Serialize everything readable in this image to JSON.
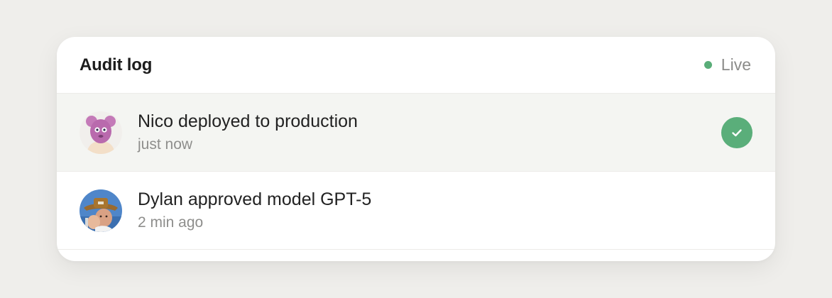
{
  "header": {
    "title": "Audit log",
    "status_label": "Live",
    "status_color": "#59ad78"
  },
  "entries": [
    {
      "text": "Nico deployed to production",
      "time": "just now",
      "avatar": "pink-monster-avatar",
      "status_icon": "check-circle-icon",
      "highlighted": true
    },
    {
      "text": "Dylan approved model GPT-5",
      "time": "2 min ago",
      "avatar": "photo-avatar"
    }
  ],
  "colors": {
    "accent": "#5aae7a",
    "row_highlight": "#f4f5f2"
  }
}
